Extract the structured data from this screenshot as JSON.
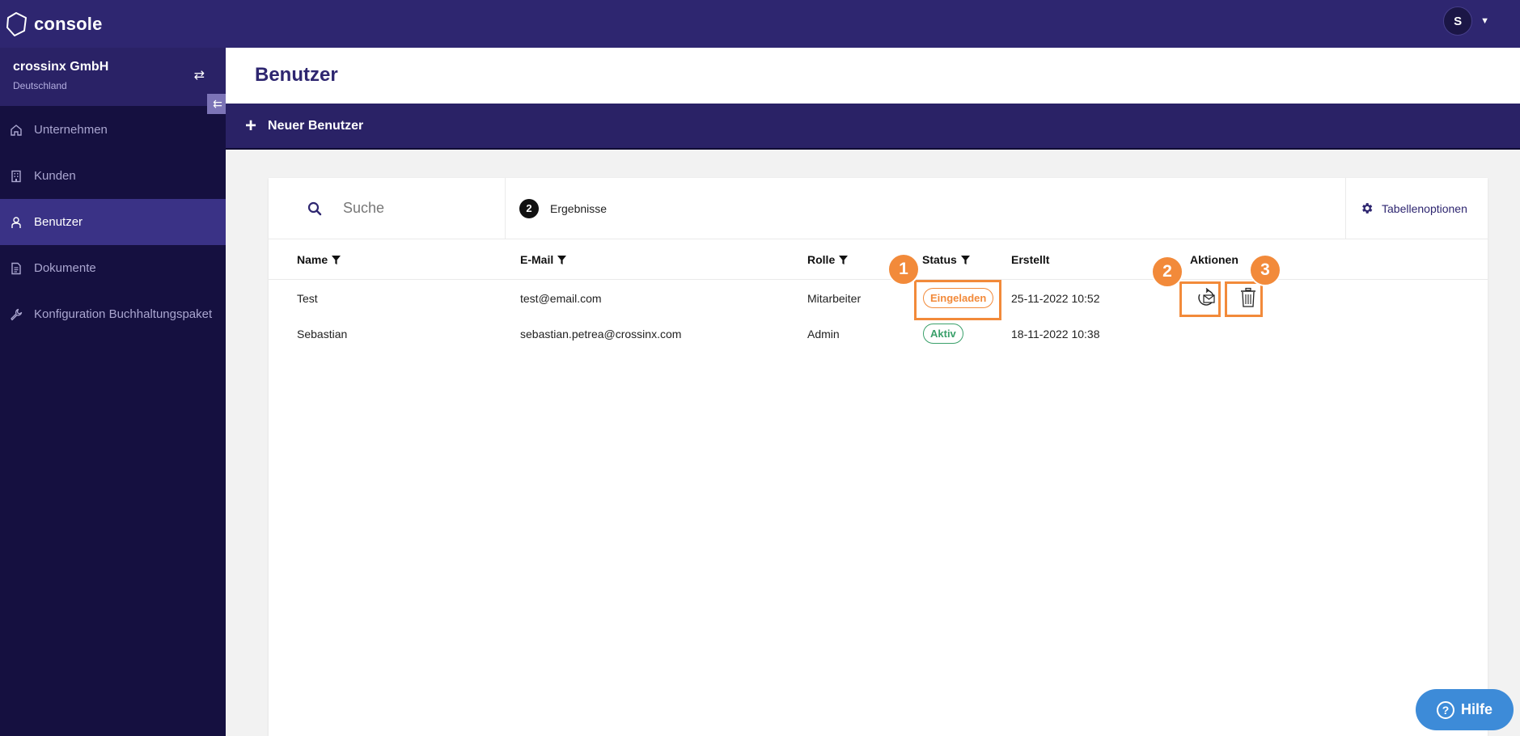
{
  "app": {
    "logo_text": "console",
    "user_initial": "S"
  },
  "company": {
    "name": "crossinx GmbH",
    "country": "Deutschland"
  },
  "sidebar": {
    "items": [
      {
        "label": "Unternehmen",
        "icon": "home-icon"
      },
      {
        "label": "Kunden",
        "icon": "building-icon"
      },
      {
        "label": "Benutzer",
        "icon": "user-icon",
        "active": true
      },
      {
        "label": "Dokumente",
        "icon": "document-icon"
      },
      {
        "label": "Konfiguration Buchhaltungspaket",
        "icon": "wrench-icon"
      }
    ]
  },
  "page": {
    "title": "Benutzer",
    "new_user_label": "Neuer Benutzer"
  },
  "toolbar": {
    "search_placeholder": "Suche",
    "results_count": "2",
    "results_label": "Ergebnisse",
    "table_options_label": "Tabellenoptionen"
  },
  "table": {
    "headers": {
      "name": "Name",
      "email": "E-Mail",
      "role": "Rolle",
      "status": "Status",
      "created": "Erstellt",
      "actions": "Aktionen"
    },
    "rows": [
      {
        "name": "Test",
        "email": "test@email.com",
        "role": "Mitarbeiter",
        "status": "Eingeladen",
        "created": "25-11-2022 10:52"
      },
      {
        "name": "Sebastian",
        "email": "sebastian.petrea@crossinx.com",
        "role": "Admin",
        "status": "Aktiv",
        "created": "18-11-2022 10:38"
      }
    ]
  },
  "annotations": {
    "marker1": "1",
    "marker2": "2",
    "marker3": "3"
  },
  "help": {
    "label": "Hilfe"
  },
  "colors": {
    "topbar": "#2e2670",
    "sidebar": "#151040",
    "highlight": "#f28a3a",
    "status_active": "#3aa06a",
    "help": "#3d8bd8"
  }
}
